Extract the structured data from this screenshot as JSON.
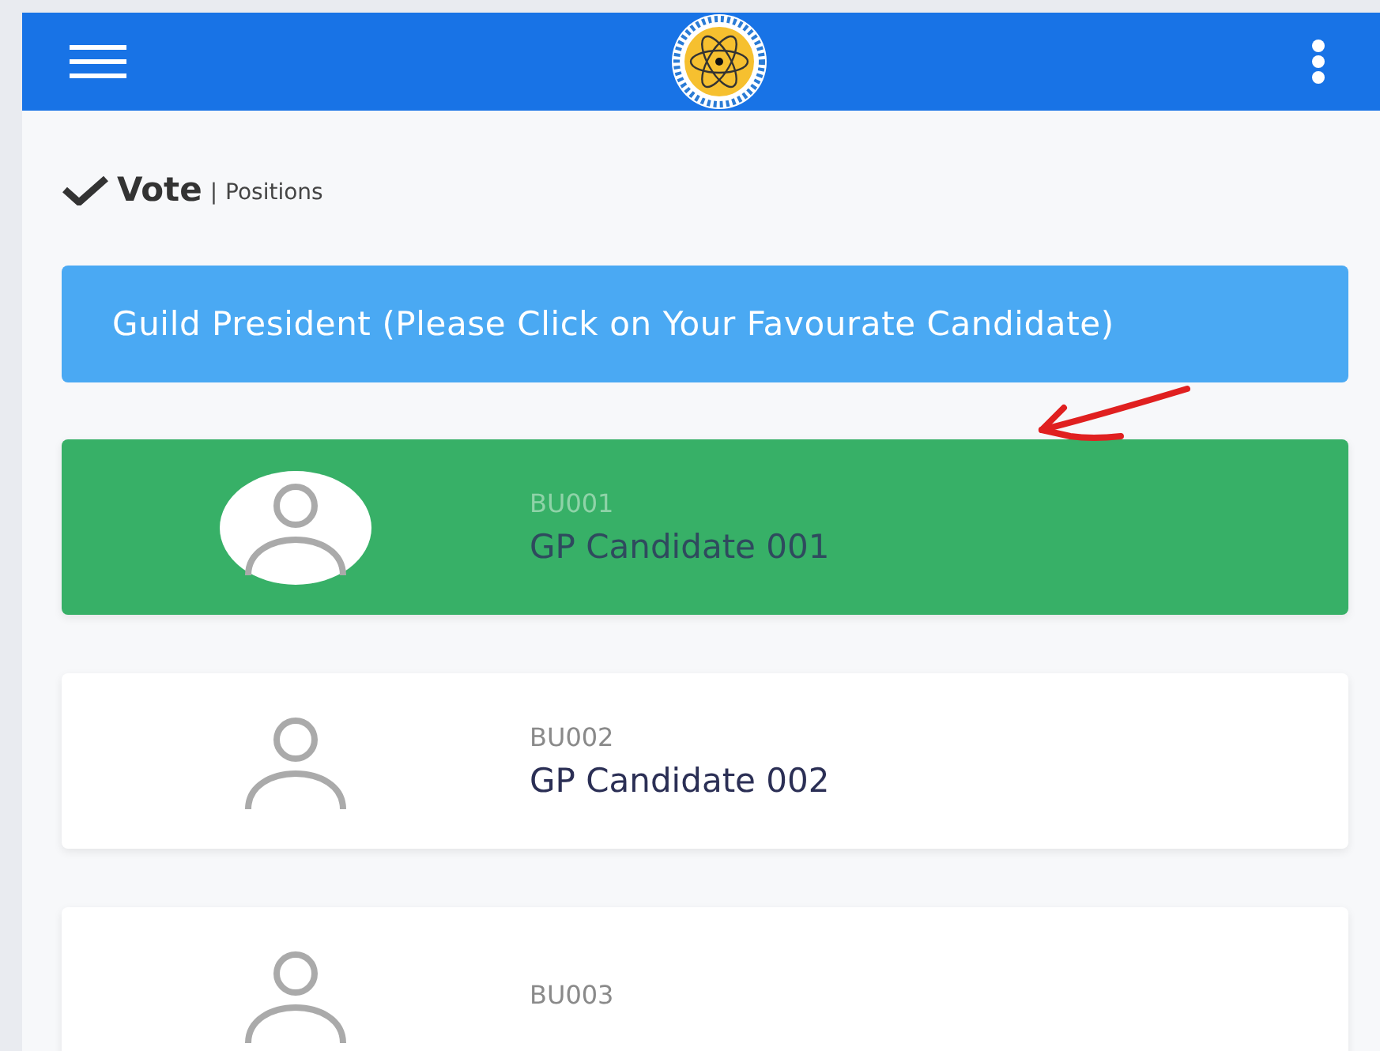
{
  "page_title": {
    "heading": "Vote",
    "separator": "|",
    "subheading": "Positions"
  },
  "position": {
    "title": "Guild President (Please Click on Your Favourate Candidate)"
  },
  "candidates": [
    {
      "code": "BU001",
      "name": "GP Candidate 001",
      "selected": true
    },
    {
      "code": "BU002",
      "name": "GP Candidate 002",
      "selected": false
    },
    {
      "code": "BU003",
      "selected": false
    }
  ]
}
